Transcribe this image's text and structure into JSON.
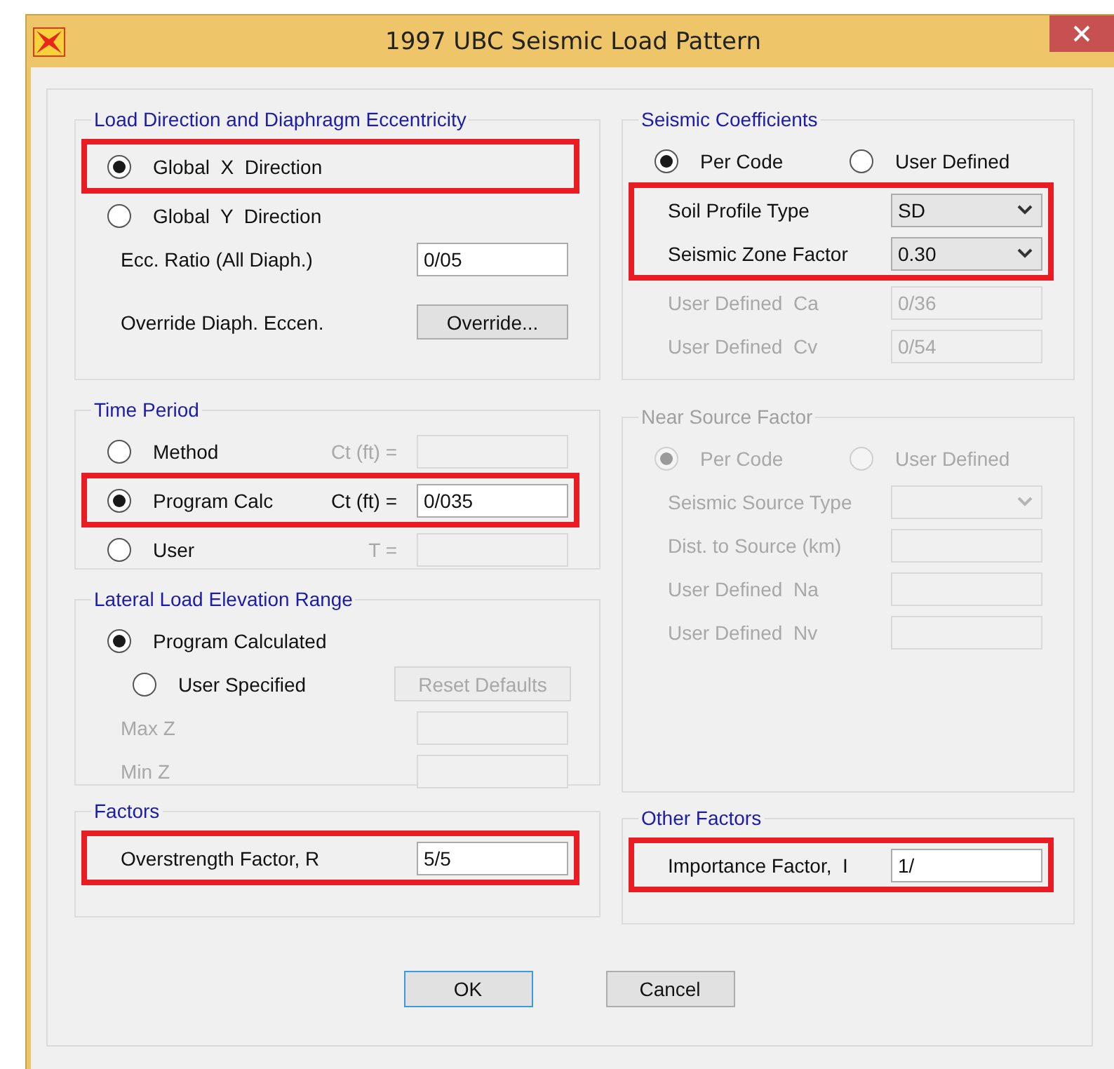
{
  "window": {
    "title": "1997 UBC Seismic Load Pattern"
  },
  "left_column": [
    {
      "title": "Load Direction and Diaphragm Eccentricity",
      "disabled": false,
      "rows": [
        {
          "kind": "highlight",
          "rows": [
            {
              "kind": "radio",
              "label": "Global  X  Direction",
              "selected": true,
              "disabled": false
            }
          ]
        },
        {
          "kind": "radio",
          "label": "Global  Y  Direction",
          "selected": false,
          "disabled": false
        },
        {
          "kind": "field",
          "label": "Ecc. Ratio (All Diaph.)",
          "value": "0/05",
          "disabled": false
        },
        {
          "kind": "button",
          "label": "Override Diaph. Eccen.",
          "button": "Override...",
          "disabled": false
        }
      ]
    },
    {
      "title": "Time Period",
      "disabled": false,
      "rows": [
        {
          "kind": "radio_field",
          "label": "Method",
          "selected": false,
          "field_label": "Ct (ft) =",
          "field_disabled": true
        },
        {
          "kind": "highlight",
          "rows": [
            {
              "kind": "radio_field",
              "label": "Program Calc",
              "selected": true,
              "field_label": "Ct (ft) =",
              "value": "0/035",
              "field_disabled": false
            }
          ]
        },
        {
          "kind": "radio_field",
          "label": "User",
          "selected": false,
          "field_label": "T =",
          "field_disabled": true
        }
      ]
    },
    {
      "title": "Lateral Load Elevation Range",
      "disabled": false,
      "rows": [
        {
          "kind": "radio",
          "label": "Program Calculated",
          "selected": true,
          "disabled": false
        },
        {
          "kind": "radio_button",
          "label": "User Specified",
          "selected": false,
          "button": "Reset Defaults",
          "button_disabled": true
        },
        {
          "kind": "field",
          "label": "Max Z",
          "disabled": true
        },
        {
          "kind": "field",
          "label": "Min Z",
          "disabled": true
        }
      ]
    },
    {
      "title": "Factors",
      "disabled": false,
      "rows": [
        {
          "kind": "highlight",
          "rows": [
            {
              "kind": "field",
              "label": "Overstrength Factor, R",
              "value": "5/5",
              "disabled": false
            }
          ]
        }
      ]
    }
  ],
  "right_column": [
    {
      "title": "Seismic Coefficients",
      "disabled": false,
      "rows": [
        {
          "kind": "radio_pair",
          "options": [
            {
              "label": "Per Code",
              "selected": true
            },
            {
              "label": "User Defined",
              "selected": false
            }
          ],
          "disabled": false
        },
        {
          "kind": "highlight",
          "rows": [
            {
              "kind": "dropdown",
              "label": "Soil Profile Type",
              "value": "SD",
              "disabled": false
            },
            {
              "kind": "dropdown",
              "label": "Seismic Zone Factor",
              "value": "0.30",
              "disabled": false
            }
          ]
        },
        {
          "kind": "field",
          "label": "User Defined  Ca",
          "value": "0/36",
          "disabled": true
        },
        {
          "kind": "field",
          "label": "User Defined  Cv",
          "value": "0/54",
          "disabled": true
        }
      ]
    },
    {
      "title": "Near Source Factor",
      "disabled": true,
      "rows": [
        {
          "kind": "radio_pair",
          "options": [
            {
              "label": "Per Code",
              "selected": true
            },
            {
              "label": "User Defined",
              "selected": false
            }
          ],
          "disabled": true
        },
        {
          "kind": "dropdown",
          "label": "Seismic Source Type",
          "disabled": true
        },
        {
          "kind": "field",
          "label": "Dist. to Source (km)",
          "disabled": true
        },
        {
          "kind": "field",
          "label": "User Defined  Na",
          "disabled": true
        },
        {
          "kind": "field",
          "label": "User Defined  Nv",
          "disabled": true
        }
      ]
    },
    {
      "title": "Other Factors",
      "disabled": false,
      "rows": [
        {
          "kind": "highlight",
          "rows": [
            {
              "kind": "field",
              "label": "Importance Factor,  I",
              "value": "1/",
              "disabled": false
            }
          ]
        }
      ]
    }
  ],
  "buttons": [
    {
      "label": "OK",
      "default": true
    },
    {
      "label": "Cancel",
      "default": false
    }
  ]
}
